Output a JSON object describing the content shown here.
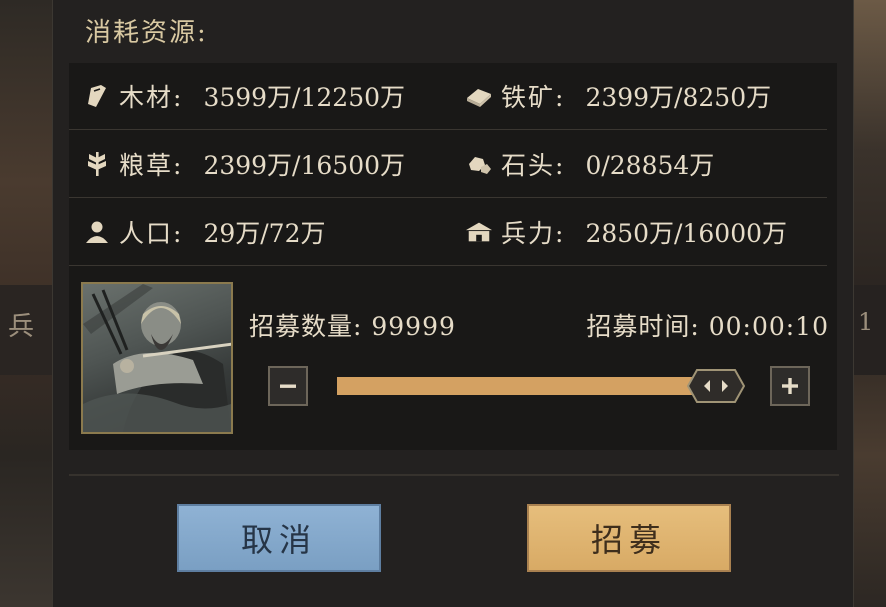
{
  "background": {
    "left_char": "兵",
    "right_char": "1"
  },
  "dialog": {
    "cost_title": "消耗资源:",
    "resources": [
      {
        "label": "木材:",
        "value": "3599万/12250万",
        "icon": "wood-icon"
      },
      {
        "label": "铁矿:",
        "value": "2399万/8250万",
        "icon": "iron-ore-icon"
      },
      {
        "label": "粮草:",
        "value": "2399万/16500万",
        "icon": "grain-icon"
      },
      {
        "label": "石头:",
        "value": "0/28854万",
        "icon": "stone-icon"
      },
      {
        "label": "人口:",
        "value": "29万/72万",
        "icon": "population-icon"
      },
      {
        "label": "兵力:",
        "value": "2850万/16000万",
        "icon": "barracks-icon"
      }
    ],
    "recruit": {
      "count_text": "招募数量: 99999",
      "time_text": "招募时间: 00:00:10",
      "slider_fraction": 1.0
    },
    "buttons": {
      "cancel": "取消",
      "confirm": "招募"
    }
  },
  "colors": {
    "accent_gold": "#d4a162",
    "cancel_blue": "#7a9fc3",
    "confirm_gold": "#d8aa65"
  }
}
